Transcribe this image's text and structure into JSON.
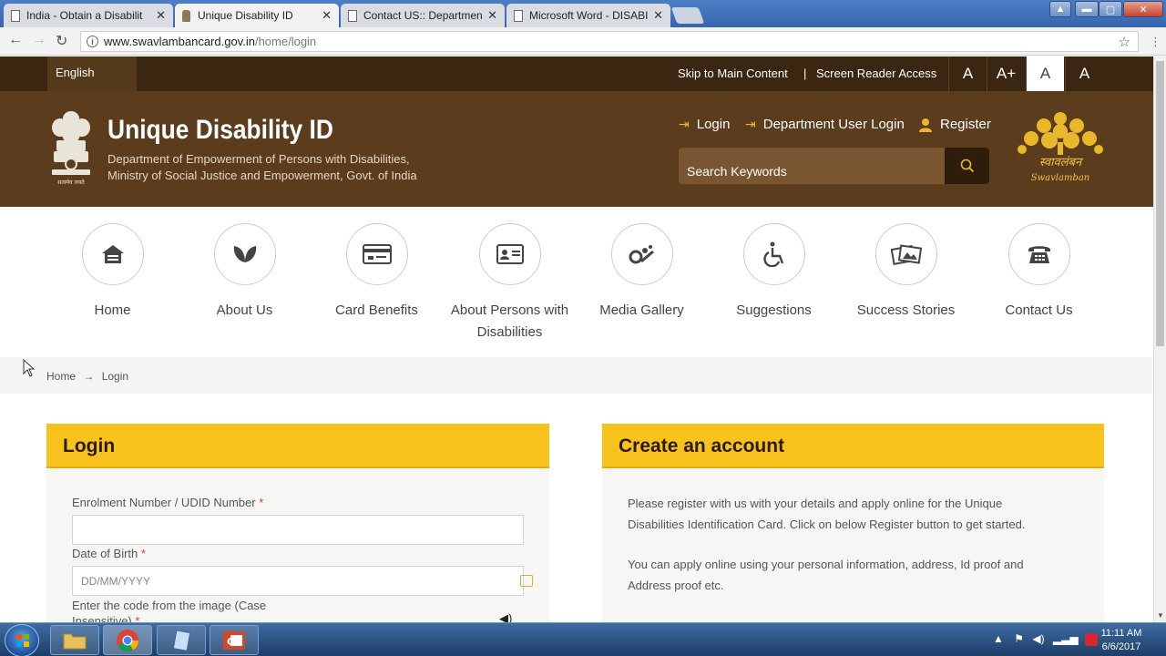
{
  "browser": {
    "tabs": [
      {
        "title": "India - Obtain a Disabilit",
        "active": false
      },
      {
        "title": "Unique Disability ID",
        "active": true
      },
      {
        "title": "Contact US:: Department",
        "active": false
      },
      {
        "title": "Microsoft Word - DISABI",
        "active": false
      }
    ],
    "url_host": "www.swavlambancard.gov.in",
    "url_path": "/home/login"
  },
  "utility": {
    "language": "English",
    "skip_link": "Skip to Main Content",
    "separator": "|",
    "screen_reader": "Screen Reader Access",
    "font_buttons": [
      "A",
      "A+",
      "A",
      "A"
    ]
  },
  "header": {
    "emblem_caption": "सत्यमेव जयते",
    "title": "Unique Disability ID",
    "subtitle_line1": "Department of Empowerment of Persons with Disabilities,",
    "subtitle_line2": "Ministry of Social Justice and Empowerment, Govt. of India",
    "login": "Login",
    "dept_login": "Department User Login",
    "register": "Register",
    "search_placeholder": "Search Keywords",
    "logo_text_hindi": "स्वावलंबन",
    "logo_text_latin": "Swavlamban",
    "accent_color": "#f2b52a"
  },
  "nav": [
    {
      "label": "Home",
      "icon": "home-icon"
    },
    {
      "label": "About Us",
      "icon": "leaf-icon"
    },
    {
      "label": "Card Benefits",
      "icon": "card-icon"
    },
    {
      "label": "About Persons with Disabilities",
      "icon": "id-card-icon"
    },
    {
      "label": "Media Gallery",
      "icon": "media-icon"
    },
    {
      "label": "Suggestions",
      "icon": "wheelchair-icon"
    },
    {
      "label": "Success Stories",
      "icon": "photo-icon"
    },
    {
      "label": "Contact Us",
      "icon": "telephone-icon"
    }
  ],
  "breadcrumb": {
    "home": "Home",
    "arrow": "→",
    "current": "Login"
  },
  "login": {
    "title": "Login",
    "enrol_label": "Enrolment Number / UDID Number",
    "required": "*",
    "dob_label": "Date of Birth",
    "dob_placeholder": "DD/MM/YYYY",
    "captcha_label_1": "Enter the code from the image (Case",
    "captcha_label_2": "Insensitive)"
  },
  "create": {
    "title": "Create an account",
    "p1_line1": "Please register with us with your details and apply online for the Unique",
    "p1_line2": "Disabilities Identification Card. Click on below Register button to get started.",
    "p2_line1": "You can apply online using your personal information, address, Id proof and",
    "p2_line2": "Address proof etc."
  },
  "taskbar": {
    "time": "11:11 AM",
    "date": "6/6/2017"
  }
}
